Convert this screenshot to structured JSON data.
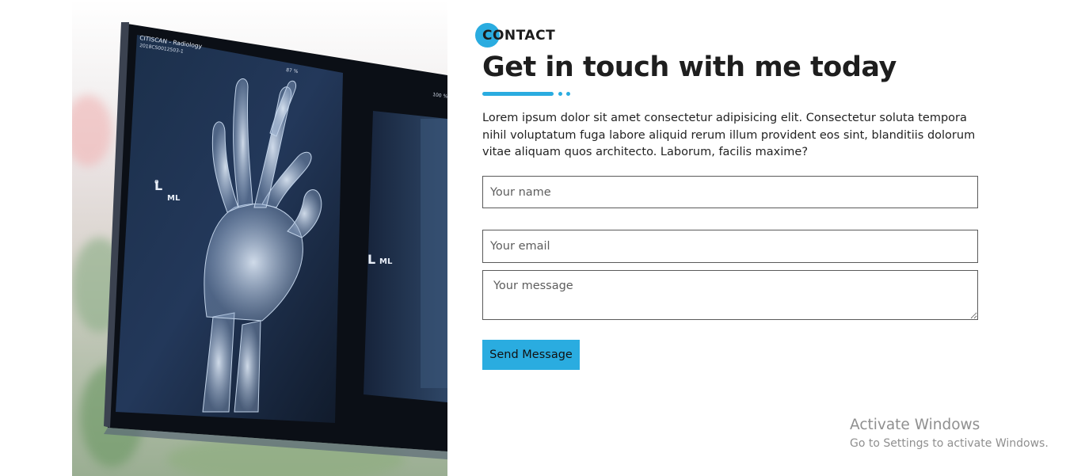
{
  "section": {
    "eyebrow": "CONTACT",
    "title": "Get in touch with me today",
    "intro": "Lorem ipsum dolor sit amet consectetur adipisicing elit. Consectetur soluta tempora nihil voluptatum fuga labore aliquid rerum illum provident eos sint, blanditiis dolorum vitae aliquam quos architecto. Laborum, facilis maxime?"
  },
  "photo": {
    "film_header": "CITISCAN - Radiology",
    "film_id": "2018CS0012503-1",
    "scale_left": "87 %",
    "scale_right": "100 %"
  },
  "form": {
    "name_placeholder": "Your name",
    "email_placeholder": "Your email",
    "message_placeholder": "Your message",
    "submit_label": "Send Message"
  },
  "watermark": {
    "title": "Activate Windows",
    "subtitle": "Go to Settings to activate Windows."
  },
  "colors": {
    "accent": "#2aace0",
    "text": "#1e1e1e",
    "border": "#5a5a5a"
  }
}
